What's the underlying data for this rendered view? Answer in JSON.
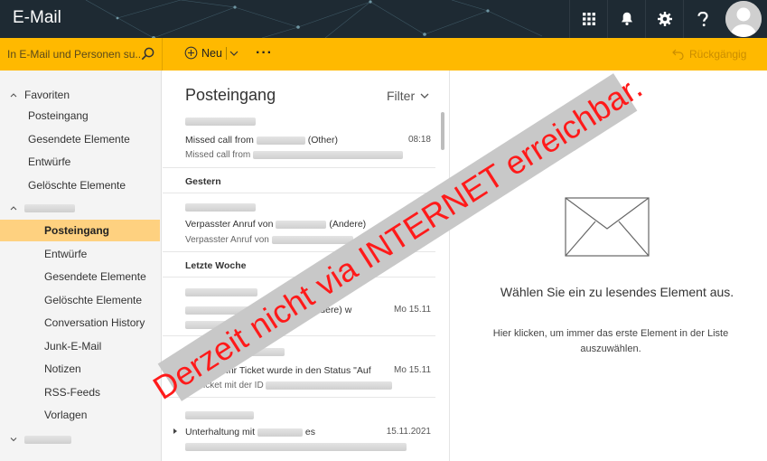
{
  "app": {
    "title": "E-Mail"
  },
  "header": {
    "icons": [
      "app-launcher-icon",
      "bell-icon",
      "gear-icon",
      "help-icon",
      "avatar-icon"
    ]
  },
  "commandbar": {
    "search_placeholder": "In E-Mail und Personen su...",
    "new_label": "Neu",
    "undo_label": "Rückgängig"
  },
  "folders": {
    "favorites_label": "Favoriten",
    "favorites": [
      "Posteingang",
      "Gesendete Elemente",
      "Entwürfe",
      "Gelöschte Elemente"
    ],
    "account_items": [
      "Posteingang",
      "Entwürfe",
      "Gesendete Elemente",
      "Gelöschte Elemente",
      "Conversation History",
      "Junk-E-Mail",
      "Notizen",
      "RSS-Feeds",
      "Vorlagen"
    ],
    "selected": "Posteingang"
  },
  "list": {
    "title": "Posteingang",
    "filter_label": "Filter",
    "groups": {
      "yesterday": "Gestern",
      "last_week": "Letzte Woche"
    },
    "messages": [
      {
        "subject_pre": "Missed call from",
        "subject_post": "(Other)",
        "preview": "Missed call from",
        "time": "08:18"
      },
      {
        "subject_pre": "Verpasster Anruf von",
        "subject_post": "(Andere)",
        "preview": "Verpasster Anruf von",
        "time": ""
      },
      {
        "subject_pre": "",
        "subject_post": "(Andere) w",
        "preview": "von",
        "time": "Mo 15.11"
      },
      {
        "subject_pre": "",
        "subject_post": "Ihr Ticket wurde in den Status \"Auf",
        "preview": "Ihr Ticket mit der ID",
        "time": "Mo 15.11"
      },
      {
        "subject_pre": "Unterhaltung mit",
        "subject_post": "es",
        "preview": "",
        "time": "15.11.2021"
      }
    ]
  },
  "reading": {
    "empty_title": "Wählen Sie ein zu lesendes Element aus.",
    "empty_hint": "Hier klicken, um immer das erste Element in der Liste auszuwählen."
  },
  "banner": {
    "text": "Derzeit nicht via INTERNET erreichbar."
  },
  "colors": {
    "header": "#1e2a33",
    "accent": "#ffb900",
    "selected": "#fed180",
    "banner_text": "#ff1a1a"
  }
}
